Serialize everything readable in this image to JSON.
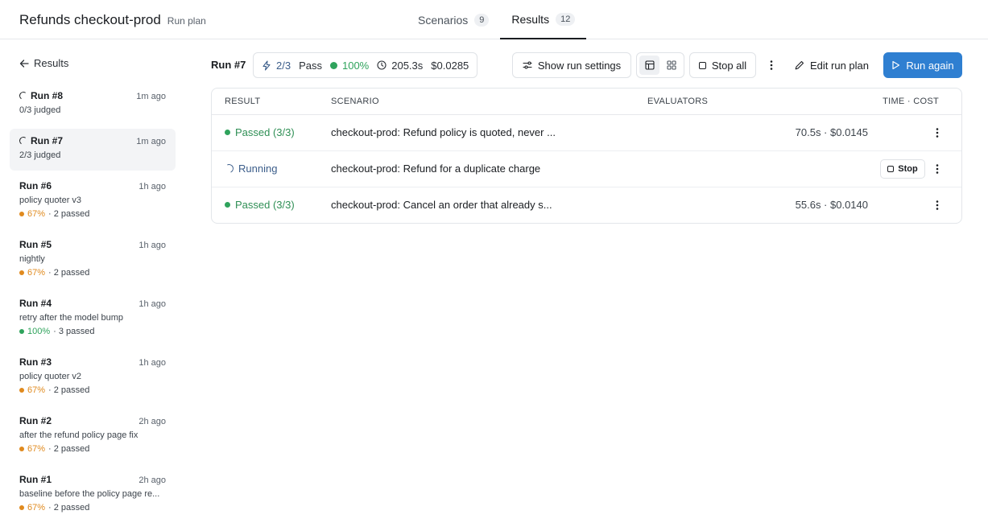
{
  "header": {
    "title": "Refunds checkout-prod",
    "subtitle": "Run plan",
    "tabs": [
      {
        "label": "Scenarios",
        "count": "9"
      },
      {
        "label": "Results",
        "count": "12"
      }
    ]
  },
  "sidebar": {
    "back_label": "Results",
    "runs": [
      {
        "name": "Run #8",
        "time": "1m ago",
        "sub": "0/3 judged"
      },
      {
        "name": "Run #7",
        "time": "1m ago",
        "sub": "2/3 judged"
      },
      {
        "name": "Run #6",
        "time": "1h ago",
        "sub": "policy quoter v3",
        "pct": "67%",
        "passed": "· 2 passed"
      },
      {
        "name": "Run #5",
        "time": "1h ago",
        "sub": "nightly",
        "pct": "67%",
        "passed": "· 2 passed"
      },
      {
        "name": "Run #4",
        "time": "1h ago",
        "sub": "retry after the model bump",
        "pct": "100%",
        "passed": "· 3 passed"
      },
      {
        "name": "Run #3",
        "time": "1h ago",
        "sub": "policy quoter v2",
        "pct": "67%",
        "passed": "· 2 passed"
      },
      {
        "name": "Run #2",
        "time": "2h ago",
        "sub": "after the refund policy page fix",
        "pct": "67%",
        "passed": "· 2 passed"
      },
      {
        "name": "Run #1",
        "time": "2h ago",
        "sub": "baseline before the policy page re...",
        "pct": "67%",
        "passed": "· 2 passed"
      }
    ]
  },
  "toolbar": {
    "run_label": "Run #7",
    "ratio": "2/3",
    "pass_label": "Pass",
    "pass_pct": "100%",
    "duration": "205.3s",
    "cost": "$0.0285",
    "show_settings": "Show run settings",
    "stop_all": "Stop all",
    "edit_plan": "Edit run plan",
    "run_again": "Run again"
  },
  "table": {
    "headers": {
      "result": "RESULT",
      "scenario": "SCENARIO",
      "evaluators": "EVALUATORS",
      "time_cost": "TIME · COST"
    },
    "rows": [
      {
        "result": "Passed (3/3)",
        "scenario": "checkout-prod: Refund policy is quoted, never ...",
        "time_cost": "70.5s · $0.0145"
      },
      {
        "result": "Running",
        "scenario": "checkout-prod: Refund for a duplicate charge",
        "stop_label": "Stop"
      },
      {
        "result": "Passed (3/3)",
        "scenario": "checkout-prod: Cancel an order that already s...",
        "time_cost": "55.6s · $0.0140"
      }
    ]
  },
  "colors": {
    "accent": "#2f7fd1",
    "pass_green": "#2fa35c",
    "warn_orange": "#e08a1e"
  }
}
